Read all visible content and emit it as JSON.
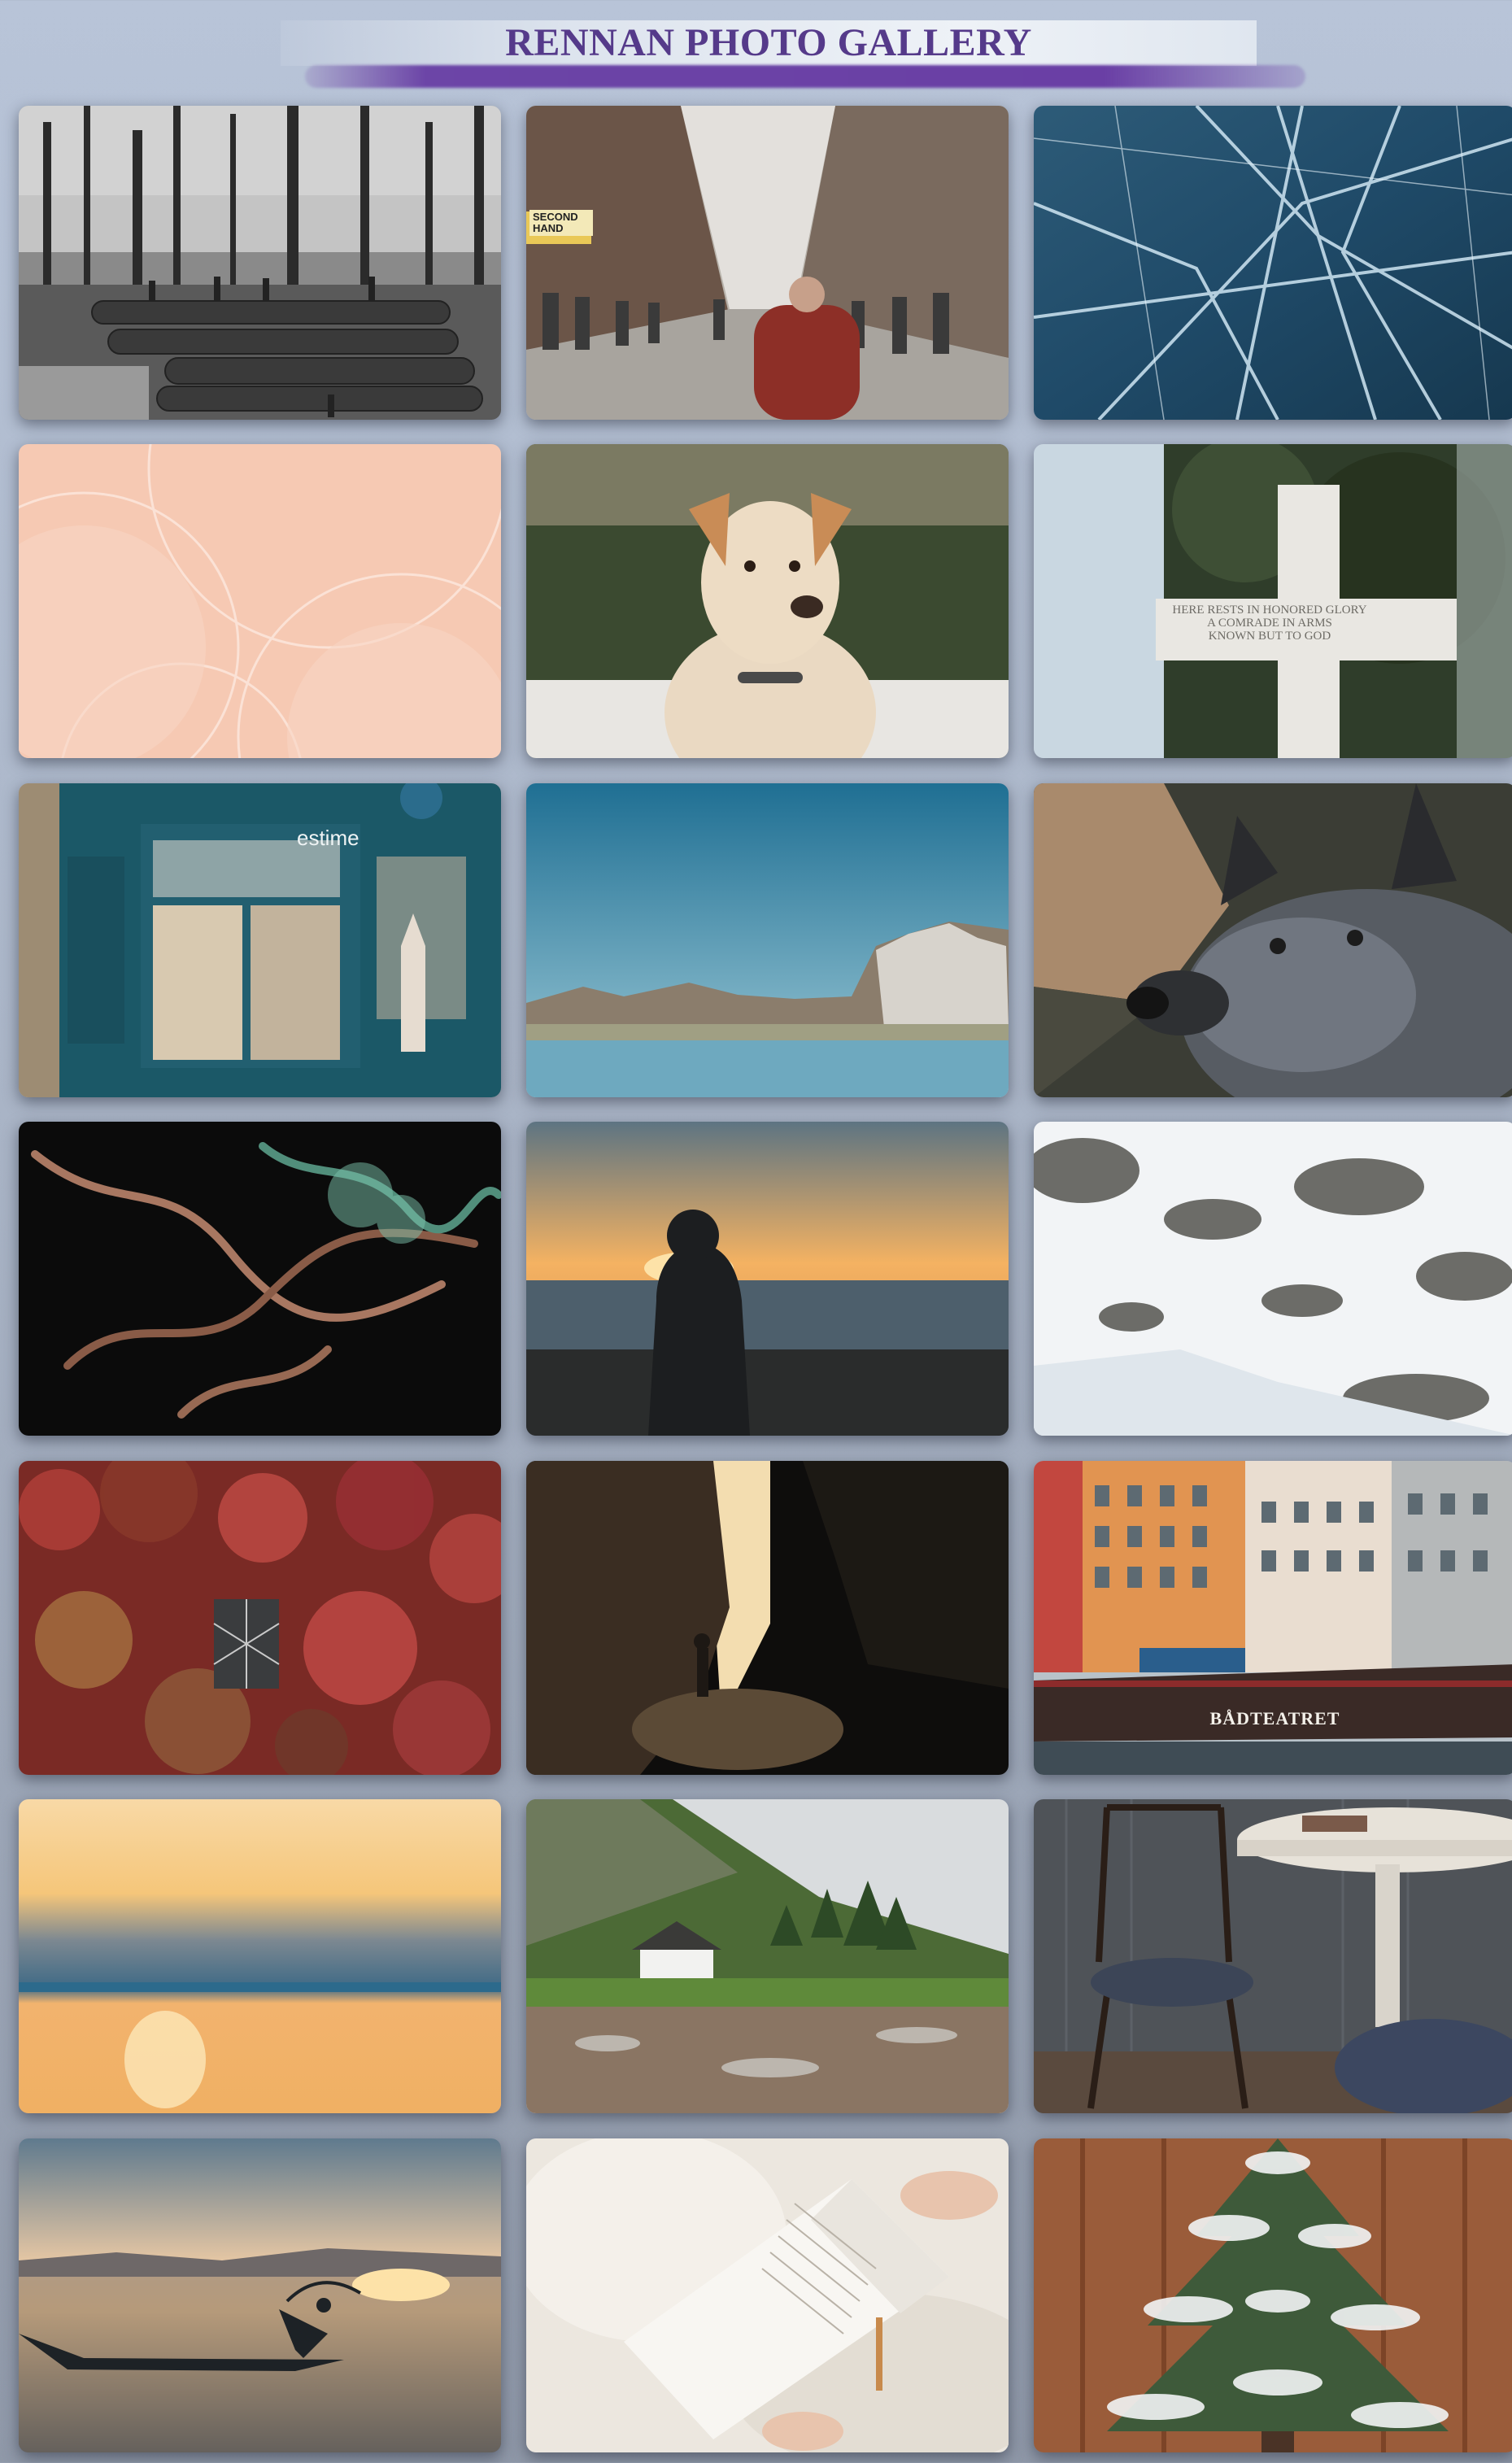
{
  "header": {
    "title": "RENNAN PHOTO GALLERY"
  },
  "gallery": {
    "photos": [
      {
        "name": "logging-camp-photo"
      },
      {
        "name": "city-street-photo",
        "shop_sign": "SECOND HAND"
      },
      {
        "name": "frozen-ice-photo"
      },
      {
        "name": "peach-abstract-photo"
      },
      {
        "name": "terrier-dog-photo"
      },
      {
        "name": "memorial-cross-photo",
        "inscription": [
          "HERE RESTS IN HONORED GLORY",
          "A COMRADE IN ARMS",
          "KNOWN BUT TO GOD"
        ]
      },
      {
        "name": "teal-cafe-photo",
        "sign": "estime"
      },
      {
        "name": "mountain-lake-photo"
      },
      {
        "name": "cattle-dog-photo"
      },
      {
        "name": "abstract-smoke-photo"
      },
      {
        "name": "sunset-silhouette-photo"
      },
      {
        "name": "snowy-mountain-photo"
      },
      {
        "name": "red-ivy-photo"
      },
      {
        "name": "sea-cave-photo"
      },
      {
        "name": "harbor-boat-photo",
        "boat_name": "BÅDTEATRET"
      },
      {
        "name": "ocean-sunrise-photo"
      },
      {
        "name": "highland-cottage-photo"
      },
      {
        "name": "chair-table-photo"
      },
      {
        "name": "fisherman-sunset-photo"
      },
      {
        "name": "reading-book-photo"
      },
      {
        "name": "snowy-pine-photo"
      }
    ]
  }
}
